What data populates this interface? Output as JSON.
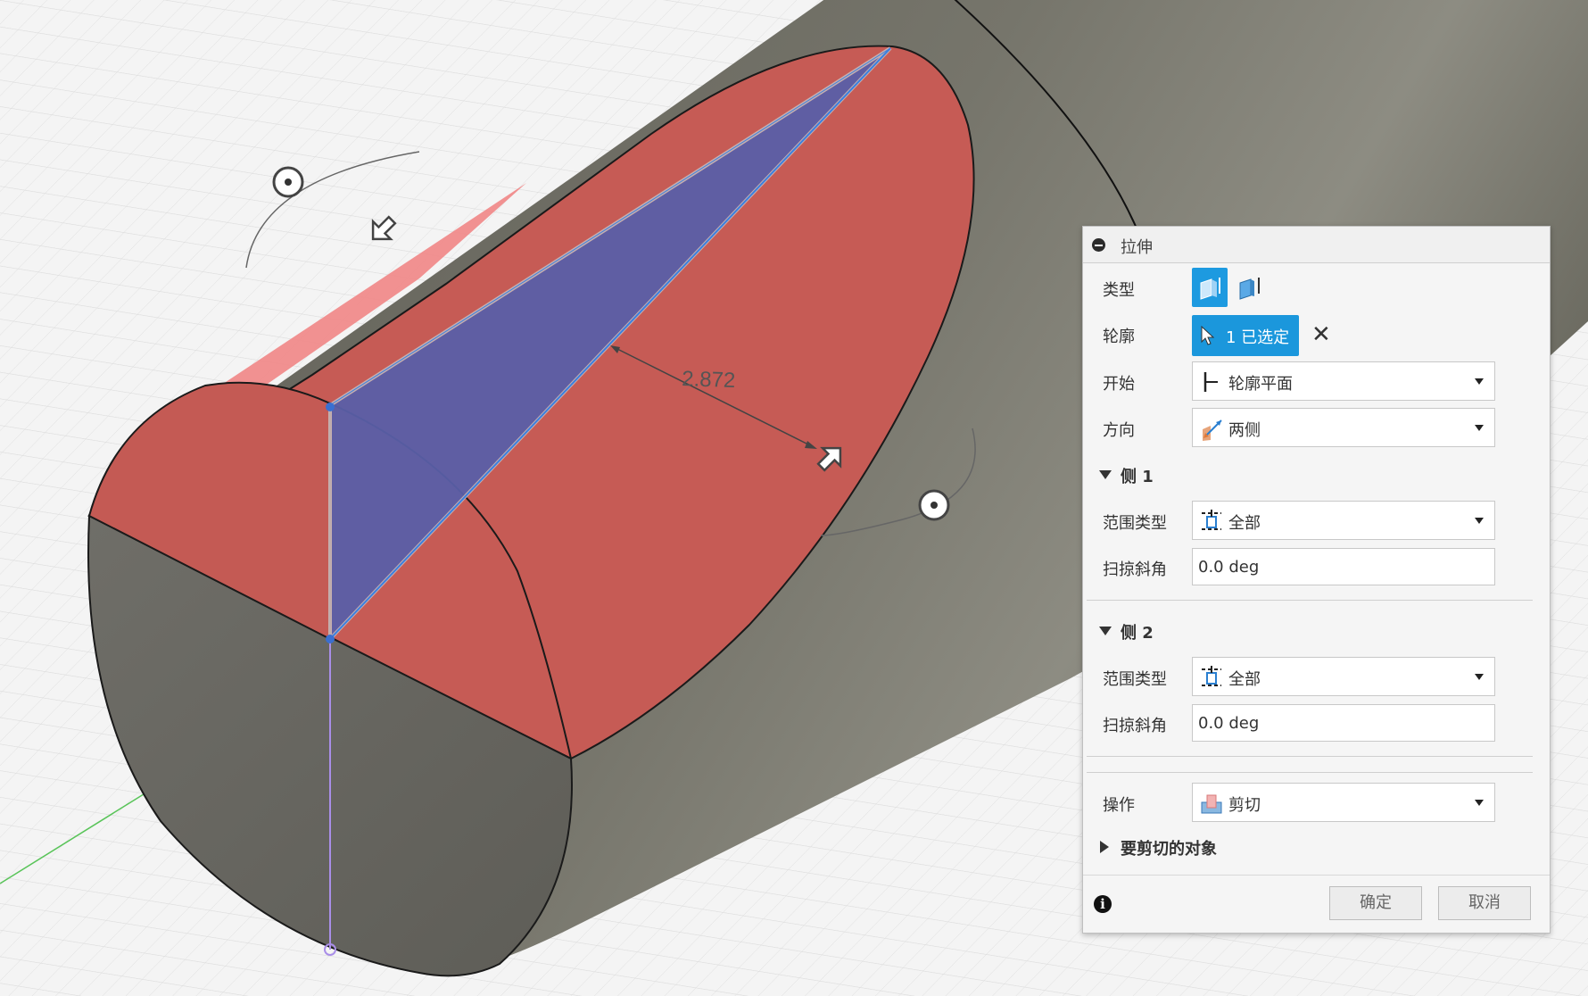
{
  "viewport": {
    "dimension_label": "2.872",
    "colors": {
      "grid_background": "#f4f4f4",
      "grid_line": "#dcdcdc",
      "body_gray": "#6e6d63",
      "cut_face_red": "#c65b55",
      "profile_blue": "#5a5fa8",
      "preview_pink": "#f08b8b",
      "sketch_line": "#a98ee8",
      "axis_green": "#59c459"
    }
  },
  "dialog": {
    "title": "拉伸",
    "type_label": "类型",
    "profile_label": "轮廓",
    "profile_selection": "1 已选定",
    "start_label": "开始",
    "start_value": "轮廓平面",
    "direction_label": "方向",
    "direction_value": "两侧",
    "side1": {
      "header": "侧 1",
      "extent_label": "范围类型",
      "extent_value": "全部",
      "taper_label": "扫掠斜角",
      "taper_value": "0.0 deg"
    },
    "side2": {
      "header": "侧 2",
      "extent_label": "范围类型",
      "extent_value": "全部",
      "taper_label": "扫掠斜角",
      "taper_value": "0.0 deg"
    },
    "operation_label": "操作",
    "operation_value": "剪切",
    "objects_to_cut": "要剪切的对象",
    "ok_button": "确定",
    "cancel_button": "取消",
    "accent_color": "#1b97dc"
  }
}
